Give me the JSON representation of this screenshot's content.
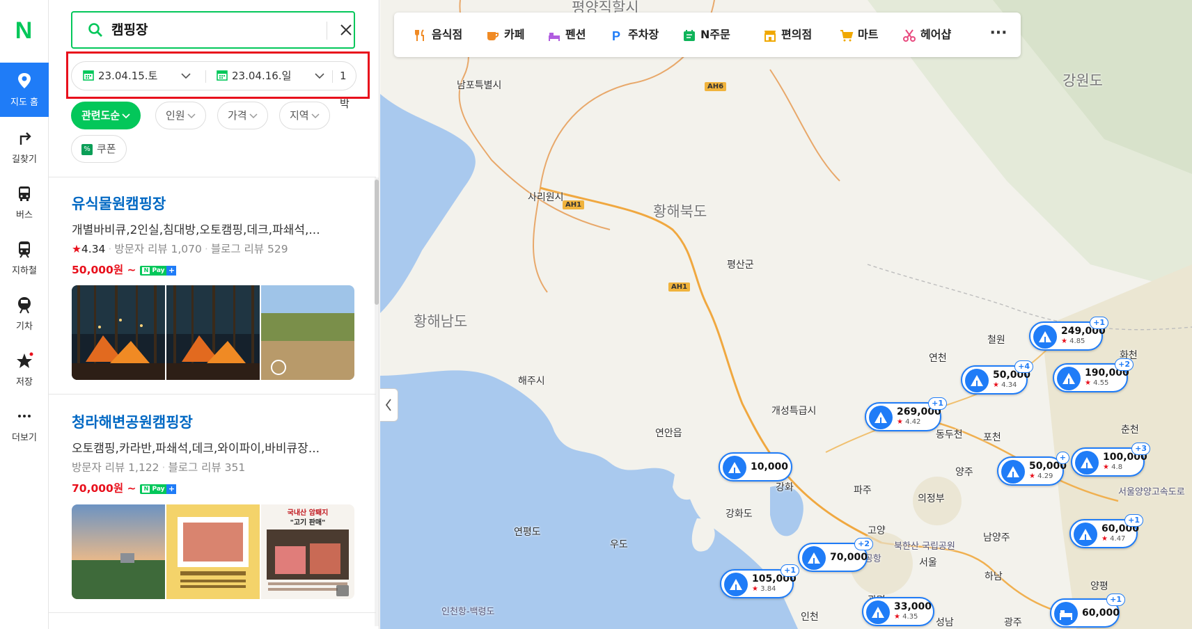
{
  "nav": {
    "logo": "N",
    "items": [
      {
        "label": "지도 홈",
        "icon": "map-pin-icon"
      },
      {
        "label": "길찾기",
        "icon": "directions-icon"
      },
      {
        "label": "버스",
        "icon": "bus-icon"
      },
      {
        "label": "지하철",
        "icon": "subway-icon"
      },
      {
        "label": "기차",
        "icon": "train-icon"
      },
      {
        "label": "저장",
        "icon": "star-icon"
      },
      {
        "label": "더보기",
        "icon": "more-icon"
      }
    ]
  },
  "search": {
    "query": "캠핑장"
  },
  "dates": {
    "checkin": "23.04.15.토",
    "checkout": "23.04.16.일",
    "nights": "1박"
  },
  "filters": {
    "sort": "관련도순",
    "chips": [
      "인원",
      "가격",
      "지역"
    ],
    "coupon": "쿠폰"
  },
  "results": [
    {
      "title": "유식물원캠핑장",
      "categories": "개별바비큐,2인실,침대방,오토캠핑,데크,파쇄석,...",
      "rating": "4.34",
      "visitor_reviews": "방문자 리뷰 1,070",
      "blog_reviews": "블로그 리뷰 529",
      "price": "50,000원 ~"
    },
    {
      "title": "청라해변공원캠핑장",
      "categories": "오토캠핑,카라반,파쇄석,데크,와이파이,바비큐장...",
      "visitor_reviews": "방문자 리뷰 1,122",
      "blog_reviews": "블로그 리뷰 351",
      "price": "70,000원 ~",
      "image3_text_line1": "국내산 암퇘지",
      "image3_text_line2": "\"고기 판매\""
    }
  ],
  "npay": {
    "label": "N Pay"
  },
  "categories": [
    {
      "label": "음식점",
      "icon": "restaurant-icon",
      "color": "#f08a24"
    },
    {
      "label": "카페",
      "icon": "cafe-icon",
      "color": "#f08a24"
    },
    {
      "label": "펜션",
      "icon": "bed-icon",
      "color": "#b15ee0"
    },
    {
      "label": "주차장",
      "icon": "parking-icon",
      "color": "#1f7cf7"
    },
    {
      "label": "N주문",
      "icon": "order-icon",
      "color": "#0fb45a"
    },
    {
      "label": "편의점",
      "icon": "store-icon",
      "color": "#f0a800"
    },
    {
      "label": "마트",
      "icon": "cart-icon",
      "color": "#f0a800"
    },
    {
      "label": "헤어샵",
      "icon": "scissors-icon",
      "color": "#e84a7f"
    }
  ],
  "more": "···",
  "map": {
    "labels": [
      {
        "text": "평양직할시"
      },
      {
        "text": "남포특별시"
      },
      {
        "text": "사리원시"
      },
      {
        "text": "황해북도"
      },
      {
        "text": "평산군"
      },
      {
        "text": "황해남도"
      },
      {
        "text": "강원도"
      },
      {
        "text": "해주시"
      },
      {
        "text": "개성특급시"
      },
      {
        "text": "연안읍"
      },
      {
        "text": "연천"
      },
      {
        "text": "철원"
      },
      {
        "text": "화천"
      },
      {
        "text": "동두천"
      },
      {
        "text": "포천"
      },
      {
        "text": "춘천"
      },
      {
        "text": "양주"
      },
      {
        "text": "파주"
      },
      {
        "text": "의정부"
      },
      {
        "text": "강화"
      },
      {
        "text": "강화도"
      },
      {
        "text": "고양"
      },
      {
        "text": "북한산 국립공원"
      },
      {
        "text": "남양주"
      },
      {
        "text": "서울"
      },
      {
        "text": "하남"
      },
      {
        "text": "양평"
      },
      {
        "text": "연평도"
      },
      {
        "text": "우도"
      },
      {
        "text": "김포국제공항"
      },
      {
        "text": "광명"
      },
      {
        "text": "인천"
      },
      {
        "text": "성남"
      },
      {
        "text": "광주"
      },
      {
        "text": "인천항-백령도"
      },
      {
        "text": "서울양양고속도로"
      }
    ],
    "routes": [
      "AH6",
      "AH1",
      "AH1"
    ],
    "markers": [
      {
        "price": "249,000",
        "rating": "4.85",
        "badge": "+1"
      },
      {
        "price": "50,000",
        "rating": "4.34",
        "badge": "+4"
      },
      {
        "price": "190,000",
        "rating": "4.55",
        "badge": "+2"
      },
      {
        "price": "269,000",
        "rating": "4.42",
        "badge": "+1"
      },
      {
        "price": "10,000"
      },
      {
        "price": "50,000",
        "rating": "4.29",
        "badge": "+"
      },
      {
        "price": "100,000",
        "rating": "4.8",
        "badge": "+3"
      },
      {
        "price": "60,000",
        "rating": "4.47",
        "badge": "+1"
      },
      {
        "price": "70,000",
        "badge": "+2"
      },
      {
        "price": "105,000",
        "rating": "3.84",
        "badge": "+1"
      },
      {
        "price": "33,000",
        "rating": "4.35"
      },
      {
        "price": "60,000",
        "badge": "+1"
      }
    ],
    "road_numbers": [
      "3",
      "5",
      "1",
      "60",
      "44",
      "6",
      "110",
      "5"
    ]
  }
}
